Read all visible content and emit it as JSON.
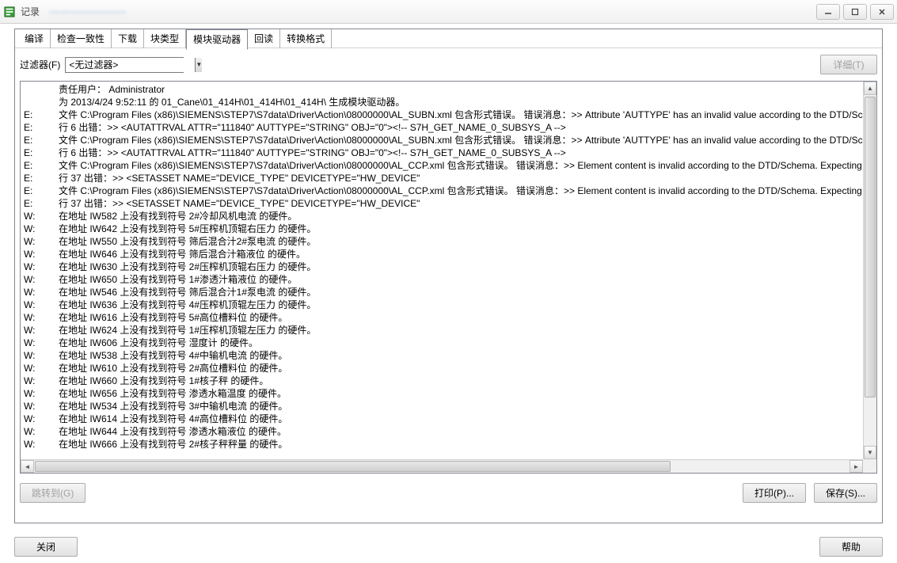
{
  "window": {
    "title": "记录",
    "blur_text": "———————"
  },
  "tabs": [
    "编译",
    "检查一致性",
    "下载",
    "块类型",
    "模块驱动器",
    "回读",
    "转换格式"
  ],
  "active_tab_index": 4,
  "filter": {
    "label": "过滤器(F)",
    "value": "<无过滤器>"
  },
  "buttons": {
    "details": "详细(T)",
    "jump": "跳转到(G)",
    "print": "打印(P)...",
    "save": "保存(S)...",
    "close": "关闭",
    "help": "帮助"
  },
  "log_header": [
    {
      "prefix": "",
      "text": "责任用户：  Administrator"
    },
    {
      "prefix": "",
      "text": "为 2013/4/24 9:52:11 的 01_Cane\\01_414H\\01_414H\\01_414H\\ 生成模块驱动器。"
    }
  ],
  "log_lines": [
    {
      "prefix": "E:",
      "text": "    文件 C:\\Program Files (x86)\\SIEMENS\\STEP7\\S7data\\Driver\\Action\\08000000\\AL_SUBN.xml 包含形式错误。 错误消息：>> Attribute 'AUTTYPE' has an invalid value according to the DTD/Schema."
    },
    {
      "prefix": "E:",
      "text": "    行 6 出错：>> <AUTATTRVAL ATTR=\"111840\" AUTTYPE=\"STRING\" OBJ=\"0\"><!-- S7H_GET_NAME_0_SUBSYS_A -->"
    },
    {
      "prefix": "E:",
      "text": "    文件 C:\\Program Files (x86)\\SIEMENS\\STEP7\\S7data\\Driver\\Action\\08000000\\AL_SUBN.xml 包含形式错误。 错误消息：>> Attribute 'AUTTYPE' has an invalid value according to the DTD/Schema."
    },
    {
      "prefix": "E:",
      "text": "    行 6 出错：>> <AUTATTRVAL ATTR=\"111840\" AUTTYPE=\"STRING\" OBJ=\"0\"><!-- S7H_GET_NAME_0_SUBSYS_A -->"
    },
    {
      "prefix": "E:",
      "text": "    文件 C:\\Program Files (x86)\\SIEMENS\\STEP7\\S7data\\Driver\\Action\\08000000\\AL_CCP.xml 包含形式错误。 错误消息：>> Element content is invalid according to the DTD/Schema.  Expecting: {x-schema:..\\Actio"
    },
    {
      "prefix": "E:",
      "text": "    行 37 出错：>> <SETASSET NAME=\"DEVICE_TYPE\" DEVICETYPE=\"HW_DEVICE\""
    },
    {
      "prefix": "E:",
      "text": "    文件 C:\\Program Files (x86)\\SIEMENS\\STEP7\\S7data\\Driver\\Action\\08000000\\AL_CCP.xml 包含形式错误。 错误消息：>> Element content is invalid according to the DTD/Schema.  Expecting: {x-schema:..\\Actio"
    },
    {
      "prefix": "E:",
      "text": "    行 37 出错：>> <SETASSET NAME=\"DEVICE_TYPE\" DEVICETYPE=\"HW_DEVICE\""
    },
    {
      "prefix": "W:",
      "text": "    在地址 IW582 上没有找到符号 2#冷却风机电流 的硬件。"
    },
    {
      "prefix": "W:",
      "text": "    在地址 IW642 上没有找到符号 5#压榨机顶辊右压力 的硬件。"
    },
    {
      "prefix": "W:",
      "text": "    在地址 IW550 上没有找到符号 筛后混合汁2#泵电流 的硬件。"
    },
    {
      "prefix": "W:",
      "text": "    在地址 IW646 上没有找到符号 筛后混合汁箱液位 的硬件。"
    },
    {
      "prefix": "W:",
      "text": "    在地址 IW630 上没有找到符号 2#压榨机顶辊右压力 的硬件。"
    },
    {
      "prefix": "W:",
      "text": "    在地址 IW650 上没有找到符号 1#渗透汁箱液位 的硬件。"
    },
    {
      "prefix": "W:",
      "text": "    在地址 IW546 上没有找到符号 筛后混合汁1#泵电流 的硬件。"
    },
    {
      "prefix": "W:",
      "text": "    在地址 IW636 上没有找到符号 4#压榨机顶辊左压力 的硬件。"
    },
    {
      "prefix": "W:",
      "text": "    在地址 IW616 上没有找到符号 5#高位槽料位 的硬件。"
    },
    {
      "prefix": "W:",
      "text": "    在地址 IW624 上没有找到符号 1#压榨机顶辊左压力 的硬件。"
    },
    {
      "prefix": "W:",
      "text": "    在地址 IW606 上没有找到符号 湿度计 的硬件。"
    },
    {
      "prefix": "W:",
      "text": "    在地址 IW538 上没有找到符号 4#中输机电流 的硬件。"
    },
    {
      "prefix": "W:",
      "text": "    在地址 IW610 上没有找到符号 2#高位槽料位 的硬件。"
    },
    {
      "prefix": "W:",
      "text": "    在地址 IW660 上没有找到符号 1#核子秤 的硬件。"
    },
    {
      "prefix": "W:",
      "text": "    在地址 IW656 上没有找到符号 渗透水箱温度 的硬件。"
    },
    {
      "prefix": "W:",
      "text": "    在地址 IW534 上没有找到符号 3#中输机电流 的硬件。"
    },
    {
      "prefix": "W:",
      "text": "    在地址 IW614 上没有找到符号 4#高位槽料位 的硬件。"
    },
    {
      "prefix": "W:",
      "text": "    在地址 IW644 上没有找到符号 渗透水箱液位 的硬件。"
    },
    {
      "prefix": "W:",
      "text": "    在地址 IW666 上没有找到符号 2#核子秤秤量 的硬件。"
    }
  ]
}
